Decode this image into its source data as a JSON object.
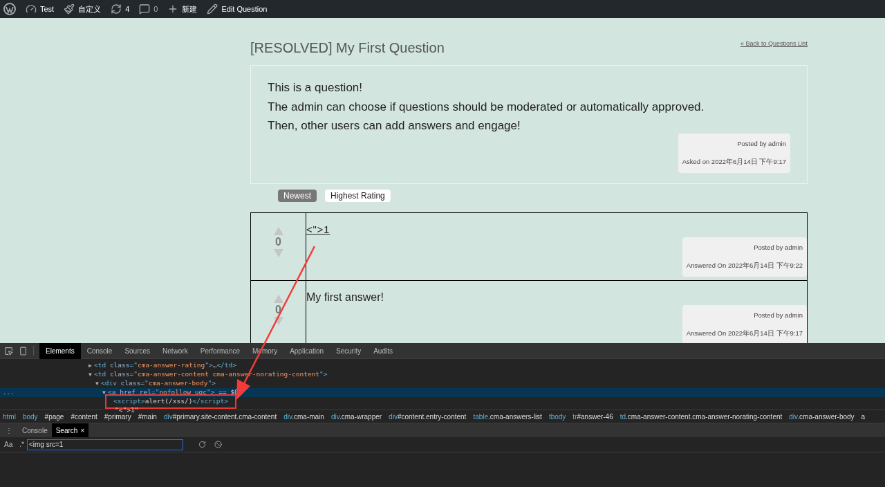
{
  "admin_bar": {
    "items": [
      {
        "kind": "logo"
      },
      {
        "kind": "dashboard",
        "label": "Test"
      },
      {
        "kind": "brush",
        "label": "自定义"
      },
      {
        "kind": "updates",
        "label": "4"
      },
      {
        "kind": "comments",
        "label": "0"
      },
      {
        "kind": "new",
        "label": "新建"
      },
      {
        "kind": "edit",
        "label": "Edit Question"
      }
    ]
  },
  "page": {
    "title": "[RESOLVED] My First Question",
    "back_link": "« Back to Questions List",
    "question": {
      "lines": [
        "This is a question!",
        "The admin can choose if questions should be moderated or automatically approved.",
        "Then, other users can add answers and engage!"
      ],
      "posted_by": "Posted by admin",
      "date": "Asked on 2022年6月14日 下午9:17"
    },
    "sort_tabs": [
      {
        "label": "Newest",
        "selected": true
      },
      {
        "label": "Highest Rating",
        "selected": false
      }
    ],
    "answers": [
      {
        "votes": "0",
        "kind": "link",
        "body": "<\">1",
        "posted_by": "Posted by admin",
        "date": "Answered On 2022年6月14日 下午9:22"
      },
      {
        "votes": "0",
        "kind": "text",
        "body": "My first answer!",
        "posted_by": "Posted by admin",
        "date": "Answered On 2022年6月14日 下午9:17"
      }
    ]
  },
  "devtools": {
    "tabs": [
      {
        "label": "Elements",
        "selected": true
      },
      {
        "label": "Console",
        "selected": false
      },
      {
        "label": "Sources",
        "selected": false
      },
      {
        "label": "Network",
        "selected": false
      },
      {
        "label": "Performance",
        "selected": false
      },
      {
        "label": "Memory",
        "selected": false
      },
      {
        "label": "Application",
        "selected": false
      },
      {
        "label": "Security",
        "selected": false
      },
      {
        "label": "Audits",
        "selected": false
      }
    ],
    "dom": [
      {
        "arrow": "▶",
        "selected": false,
        "boxed": false,
        "tokens": [
          {
            "kind": "tag",
            "text": "<td "
          },
          {
            "kind": "attr",
            "text": "class"
          },
          {
            "kind": "tag",
            "text": "=\""
          },
          {
            "kind": "value",
            "text": "cma-answer-rating"
          },
          {
            "kind": "tag",
            "text": "\">"
          },
          {
            "kind": "plain",
            "text": "…"
          },
          {
            "kind": "tag",
            "text": "</td>"
          }
        ]
      },
      {
        "arrow": "▼",
        "selected": false,
        "boxed": false,
        "tokens": [
          {
            "kind": "tag",
            "text": "<td "
          },
          {
            "kind": "attr",
            "text": "class"
          },
          {
            "kind": "tag",
            "text": "=\""
          },
          {
            "kind": "value",
            "text": "cma-answer-content cma-answer-norating-content"
          },
          {
            "kind": "tag",
            "text": "\">"
          }
        ],
        "children": [
          {
            "arrow": "▼",
            "selected": false,
            "boxed": false,
            "tokens": [
              {
                "kind": "tag",
                "text": "<div "
              },
              {
                "kind": "attr",
                "text": "class"
              },
              {
                "kind": "tag",
                "text": "=\""
              },
              {
                "kind": "value",
                "text": "cma-answer-body"
              },
              {
                "kind": "tag",
                "text": "\">"
              }
            ],
            "children": [
              {
                "arrow": "▼",
                "selected": true,
                "boxed": false,
                "marker": "...",
                "tokens": [
                  {
                    "kind": "tag",
                    "text": "<a "
                  },
                  {
                    "kind": "attr",
                    "text": "href rel"
                  },
                  {
                    "kind": "tag",
                    "text": "=\""
                  },
                  {
                    "kind": "value",
                    "text": "nofollow ugc"
                  },
                  {
                    "kind": "tag",
                    "text": "\">"
                  },
                  {
                    "kind": "plain",
                    "text": " == $0"
                  }
                ],
                "children": [
                  {
                    "selected": false,
                    "boxed": true,
                    "tokens": [
                      {
                        "kind": "tag",
                        "text": "<script>"
                      },
                      {
                        "kind": "plain",
                        "text": "alert(/xss/)"
                      },
                      {
                        "kind": "tag",
                        "text": "</script>"
                      }
                    ]
                  },
                  {
                    "selected": false,
                    "boxed": false,
                    "tokens": [
                      {
                        "kind": "plain",
                        "text": "\"<\">1\""
                      }
                    ]
                  }
                ]
              }
            ]
          }
        ]
      }
    ],
    "breadcrumbs": [
      {
        "tag": "html"
      },
      {
        "tag": "body"
      },
      {
        "rest": "#page"
      },
      {
        "rest": "#content"
      },
      {
        "rest": "#primary"
      },
      {
        "rest": "#main"
      },
      {
        "tag": "div",
        "rest": "#primary.site-content.cma-content"
      },
      {
        "tag": "div",
        "rest": ".cma-main"
      },
      {
        "tag": "div",
        "rest": ".cma-wrapper"
      },
      {
        "tag": "div",
        "rest": "#content.entry-content"
      },
      {
        "tag": "table",
        "rest": ".cma-answers-list"
      },
      {
        "tag": "tbody"
      },
      {
        "tag": "tr",
        "rest": "#answer-46"
      },
      {
        "tag": "td",
        "rest": ".cma-answer-content.cma-answer-norating-content"
      },
      {
        "tag": "div",
        "rest": ".cma-answer-body"
      },
      {
        "tag": "a"
      }
    ],
    "drawer_menu": "⋮",
    "drawer_tabs": [
      {
        "label": "Console",
        "selected": false
      },
      {
        "label": "Search",
        "selected": true,
        "close": "×"
      }
    ],
    "search": {
      "case_toggle": "Aa",
      "regex_toggle": ".*",
      "value": "<img src=1"
    }
  }
}
